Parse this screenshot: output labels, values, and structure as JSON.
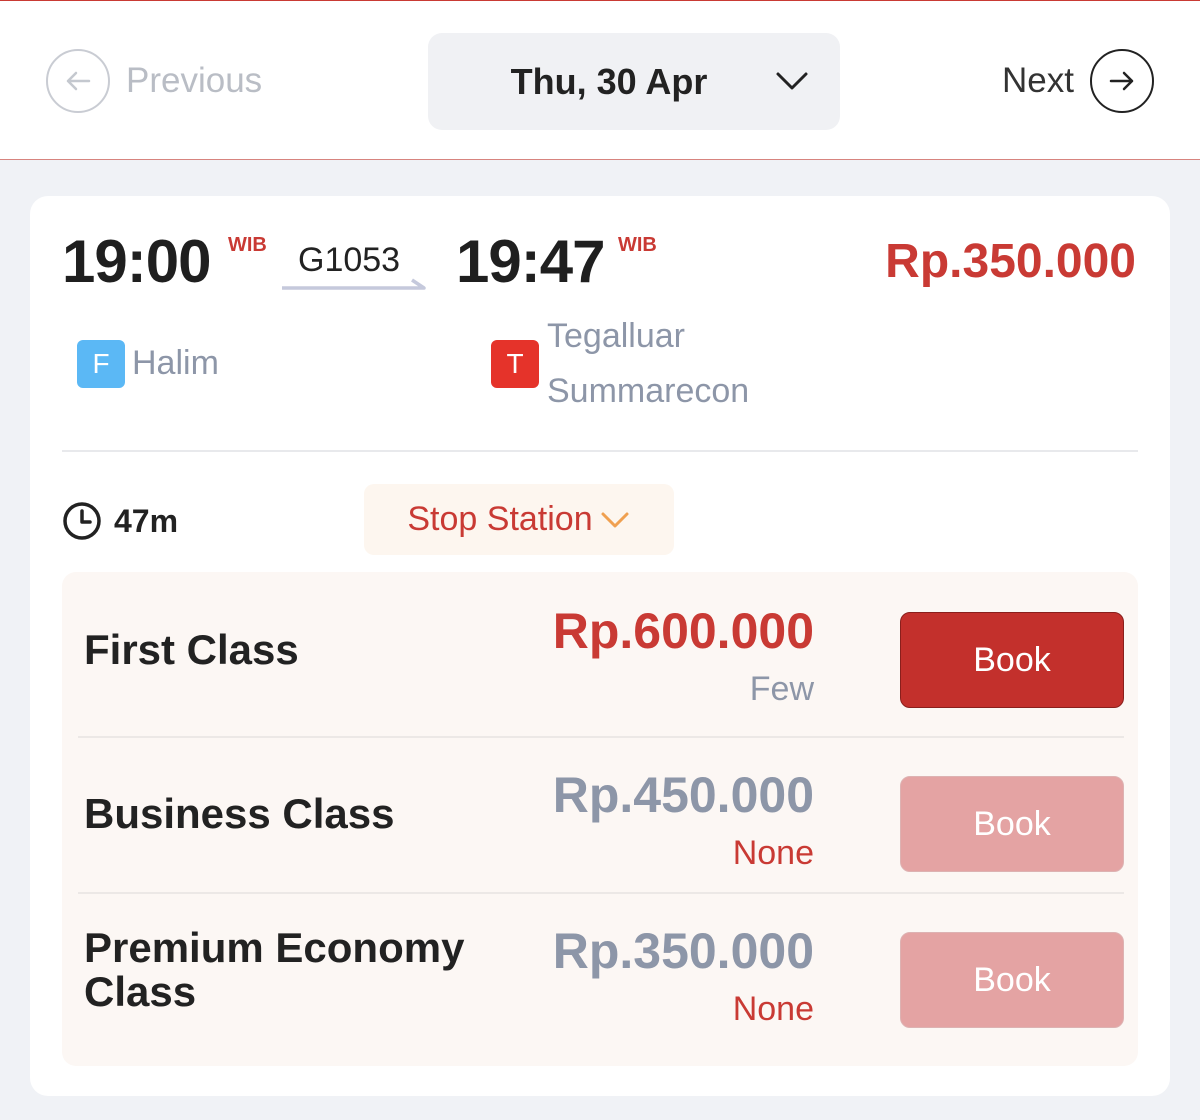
{
  "nav": {
    "previous_label": "Previous",
    "next_label": "Next",
    "date": "Thu, 30 Apr"
  },
  "trip": {
    "depart_time": "19:00",
    "depart_tz": "WIB",
    "train_number": "G1053",
    "arrive_time": "19:47",
    "arrive_tz": "WIB",
    "lowest_price": "Rp.350.000",
    "origin": {
      "badge": "F",
      "name": "Halim",
      "badge_color": "#5bb8f5"
    },
    "destination": {
      "badge": "T",
      "name_line1": "Tegalluar",
      "name_line2": "Summarecon",
      "badge_color": "#e5332a"
    },
    "duration": "47m",
    "stop_station_label": "Stop Station"
  },
  "classes": [
    {
      "name": "First Class",
      "price": "Rp.600.000",
      "availability": "Few",
      "book_label": "Book",
      "enabled": true
    },
    {
      "name": "Business Class",
      "price": "Rp.450.000",
      "availability": "None",
      "book_label": "Book",
      "enabled": false
    },
    {
      "name": "Premium Economy Class",
      "price": "Rp.350.000",
      "availability": "None",
      "book_label": "Book",
      "enabled": false
    }
  ],
  "colors": {
    "accent": "#c93a34",
    "disabled_button": "#e4a3a3",
    "muted_text": "#8d96a8"
  }
}
